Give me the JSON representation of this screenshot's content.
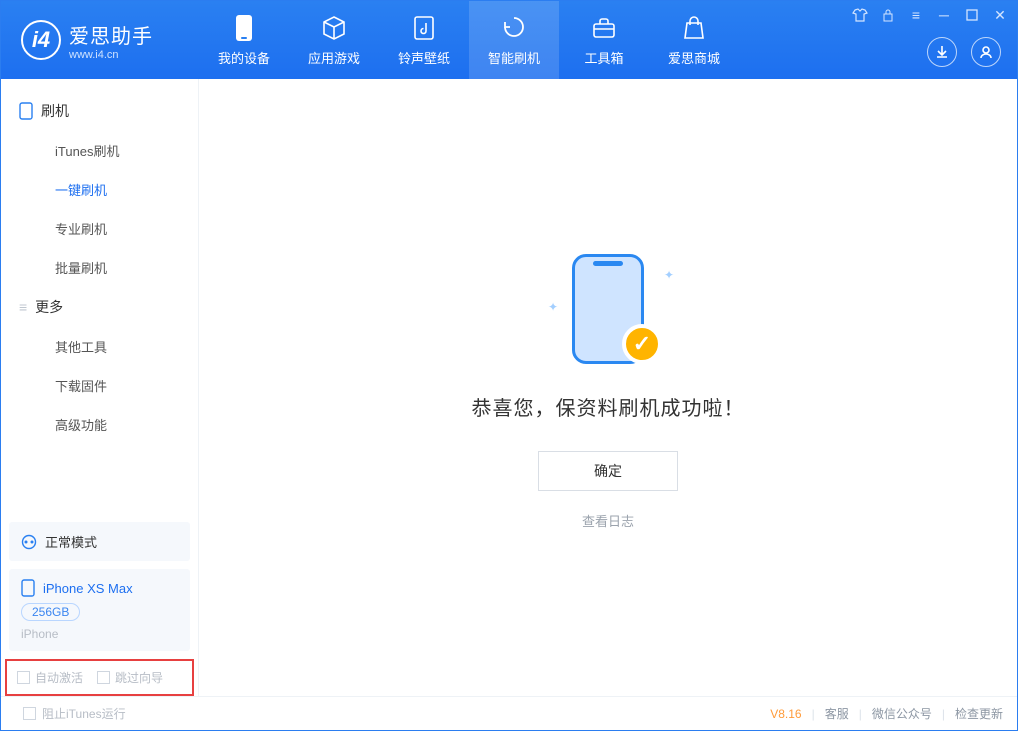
{
  "app": {
    "name_cn": "爱思助手",
    "name_en": "www.i4.cn"
  },
  "tabs": [
    {
      "label": "我的设备"
    },
    {
      "label": "应用游戏"
    },
    {
      "label": "铃声壁纸"
    },
    {
      "label": "智能刷机"
    },
    {
      "label": "工具箱"
    },
    {
      "label": "爱思商城"
    }
  ],
  "sidebar": {
    "group1_title": "刷机",
    "group1_items": [
      {
        "label": "iTunes刷机"
      },
      {
        "label": "一键刷机"
      },
      {
        "label": "专业刷机"
      },
      {
        "label": "批量刷机"
      }
    ],
    "group2_title": "更多",
    "group2_items": [
      {
        "label": "其他工具"
      },
      {
        "label": "下载固件"
      },
      {
        "label": "高级功能"
      }
    ],
    "mode_label": "正常模式",
    "device": {
      "name": "iPhone XS Max",
      "capacity": "256GB",
      "type": "iPhone"
    },
    "opt_auto_activate": "自动激活",
    "opt_skip_guide": "跳过向导"
  },
  "main": {
    "success_text": "恭喜您，保资料刷机成功啦！",
    "ok_button": "确定",
    "view_log": "查看日志"
  },
  "statusbar": {
    "stop_itunes": "阻止iTunes运行",
    "version": "V8.16",
    "link_service": "客服",
    "link_wechat": "微信公众号",
    "link_update": "检查更新"
  }
}
